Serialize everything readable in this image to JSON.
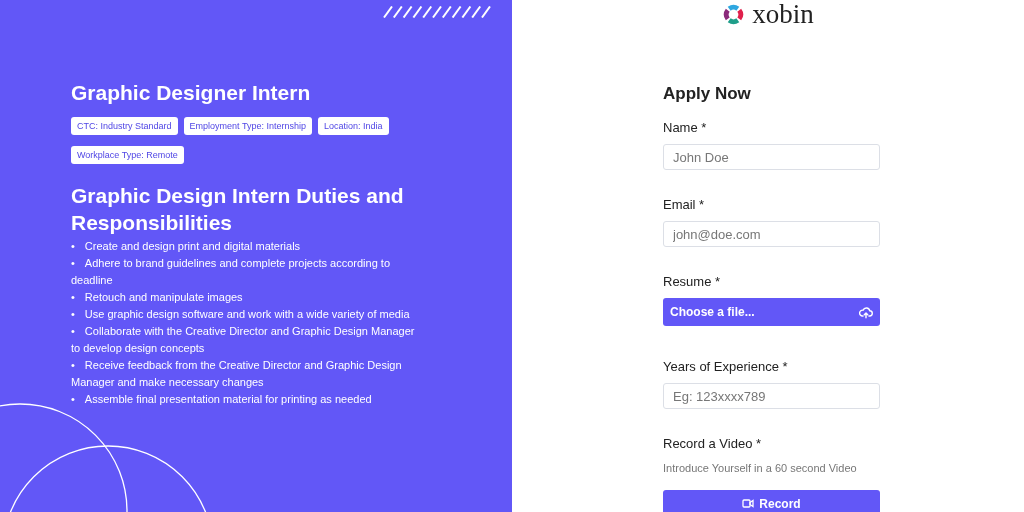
{
  "job": {
    "title": "Graphic Designer Intern",
    "tags": [
      "CTC: Industry Standard",
      "Employment Type: Internship",
      "Location: India",
      "Workplace Type: Remote"
    ],
    "section_heading": "Graphic Design Intern Duties and Responsibilities",
    "bullet": "•",
    "duties": [
      "Create and design print and digital materials",
      "Adhere to brand guidelines and complete projects according to deadline",
      "Retouch and manipulate images",
      "Use graphic design software and work with a wide variety of media",
      "Collaborate with the Creative Director and Graphic Design Manager to develop design concepts",
      "Receive feedback from the Creative Director and Graphic Design Manager and make necessary changes",
      "Assemble final presentation material for printing as needed"
    ]
  },
  "logo": {
    "text": "xobin"
  },
  "form": {
    "title": "Apply Now",
    "fields": [
      {
        "kind": "input",
        "label": "Name *",
        "placeholder": "John Doe"
      },
      {
        "kind": "input",
        "label": "Email *",
        "placeholder": "john@doe.com"
      },
      {
        "kind": "file",
        "label": "Resume *",
        "button": "Choose a file..."
      },
      {
        "kind": "input",
        "label": "Years of Experience *",
        "placeholder": "Eg: 123xxxx789"
      },
      {
        "kind": "video",
        "label": "Record a Video *",
        "hint": "Introduce Yourself in a 60 second Video",
        "button": "Record"
      }
    ]
  }
}
